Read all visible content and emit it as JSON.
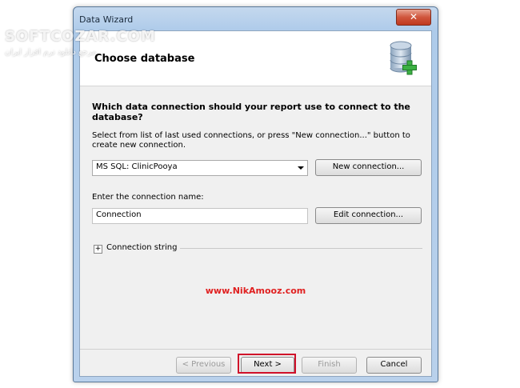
{
  "window": {
    "title": "Data Wizard",
    "close_label": "✕"
  },
  "header": {
    "title": "Choose database"
  },
  "main": {
    "question": "Which data connection should your report use to connect to the database?",
    "description": "Select from list of last used connections, or press \"New connection...\" button to create new connection.",
    "connection_select": {
      "value": "MS SQL: ClinicPooya"
    },
    "new_connection_button": "New connection...",
    "name_label": "Enter the connection name:",
    "connection_name": "Connection",
    "edit_connection_button": "Edit connection...",
    "connection_string_label": "Connection string",
    "expander_symbol": "+",
    "watermark": "www.NikAmooz.com"
  },
  "footer": {
    "previous": "< Previous",
    "next": "Next >",
    "finish": "Finish",
    "cancel": "Cancel"
  },
  "overlay": {
    "brand": "SOFTCOZAR.COM",
    "sub": "مرجع دانلود نرم افزار ایران"
  },
  "icons": {
    "database": "database-add-icon",
    "dropdown": "chevron-down-icon",
    "expander": "plus-icon"
  },
  "colors": {
    "accent_highlight": "#d0102a",
    "watermark": "#e02020",
    "db_icon_plus": "#3cb043"
  }
}
